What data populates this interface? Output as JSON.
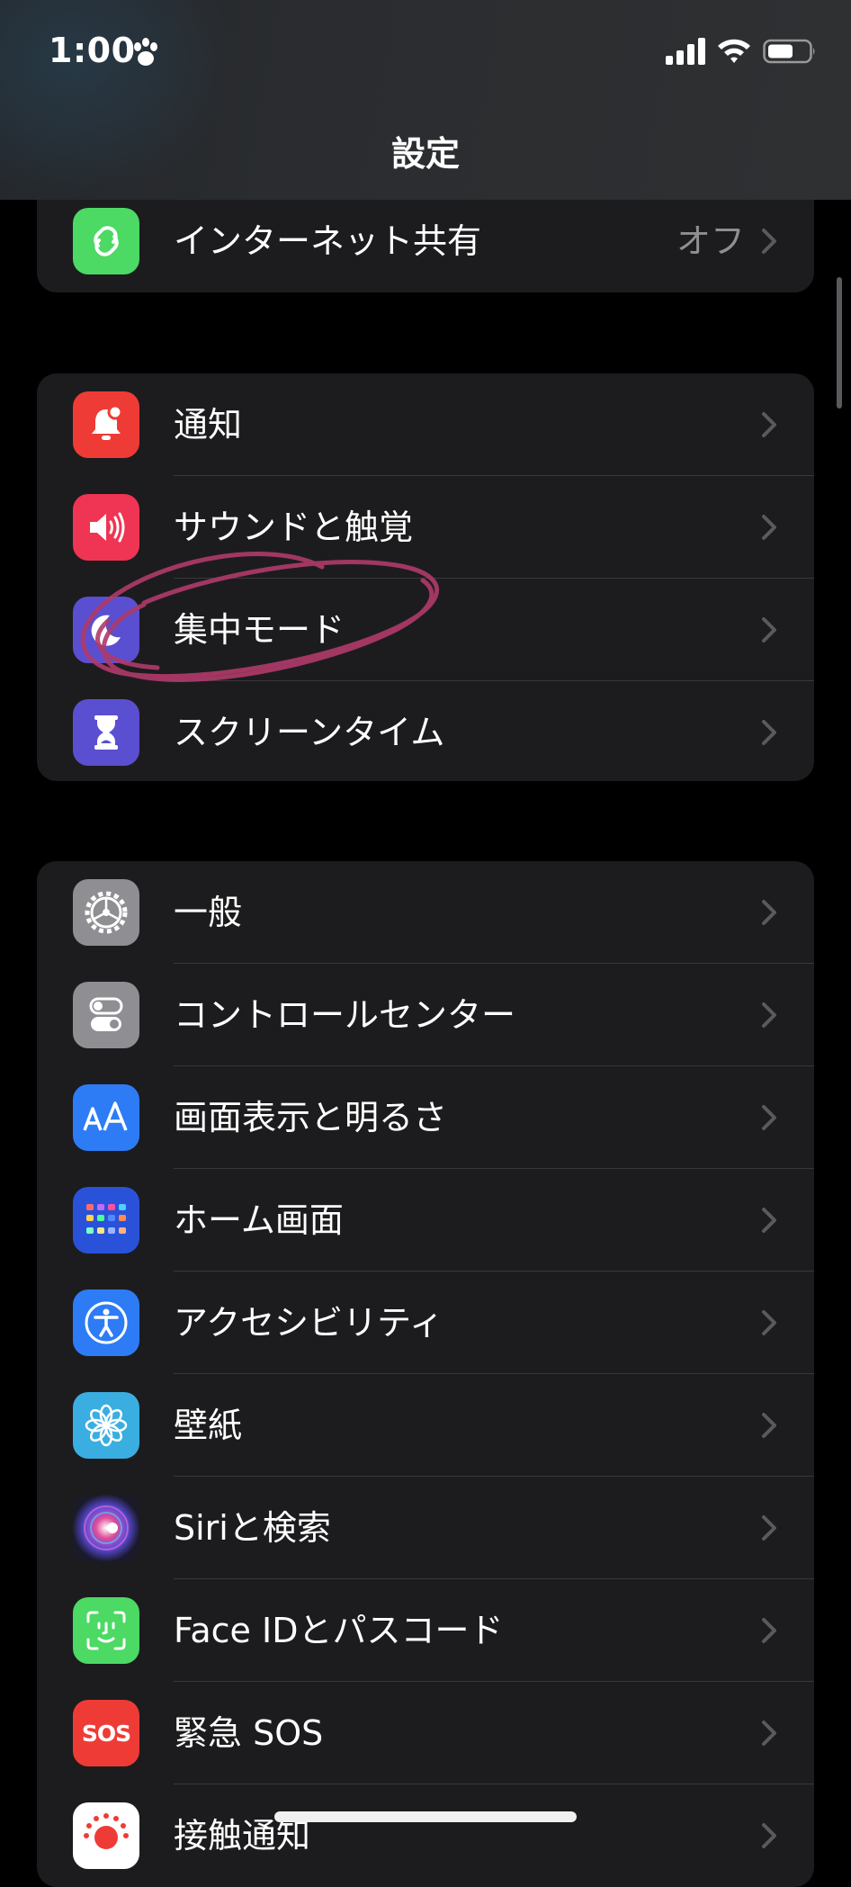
{
  "status": {
    "time": "1:00"
  },
  "nav": {
    "title": "設定"
  },
  "group1": [
    {
      "label": "インターネット共有",
      "value": "オフ",
      "icon": "hotspot-icon",
      "color": "#4cd964"
    }
  ],
  "group2": [
    {
      "label": "通知",
      "icon": "notifications-icon",
      "color": "#ef3b36"
    },
    {
      "label": "サウンドと触覚",
      "icon": "sound-icon",
      "color": "#ef3553"
    },
    {
      "label": "集中モード",
      "icon": "focus-moon-icon",
      "color": "#5a4fd0"
    },
    {
      "label": "スクリーンタイム",
      "icon": "hourglass-icon",
      "color": "#5a4fd0"
    }
  ],
  "group3": [
    {
      "label": "一般",
      "icon": "gear-icon",
      "color": "#8e8e93"
    },
    {
      "label": "コントロールセンター",
      "icon": "toggles-icon",
      "color": "#8e8e93"
    },
    {
      "label": "画面表示と明るさ",
      "icon": "text-size-icon",
      "color": "#2d7cf6"
    },
    {
      "label": "ホーム画面",
      "icon": "home-screen-icon",
      "color": "#2a52d9"
    },
    {
      "label": "アクセシビリティ",
      "icon": "accessibility-icon",
      "color": "#2d7cf6"
    },
    {
      "label": "壁紙",
      "icon": "wallpaper-flower-icon",
      "color": "#3aaee0"
    },
    {
      "label": "Siriと検索",
      "icon": "siri-icon",
      "color": "#1a1a2a"
    },
    {
      "label": "Face IDとパスコード",
      "icon": "face-id-icon",
      "color": "#4cd964"
    },
    {
      "label": "緊急 SOS",
      "icon": "sos-icon",
      "color": "#ef3b36",
      "icon_text": "SOS"
    },
    {
      "label": "接触通知",
      "icon": "exposure-notification-icon",
      "color": "#ffffff"
    }
  ],
  "ui": {
    "accent": "#b03a6a"
  }
}
